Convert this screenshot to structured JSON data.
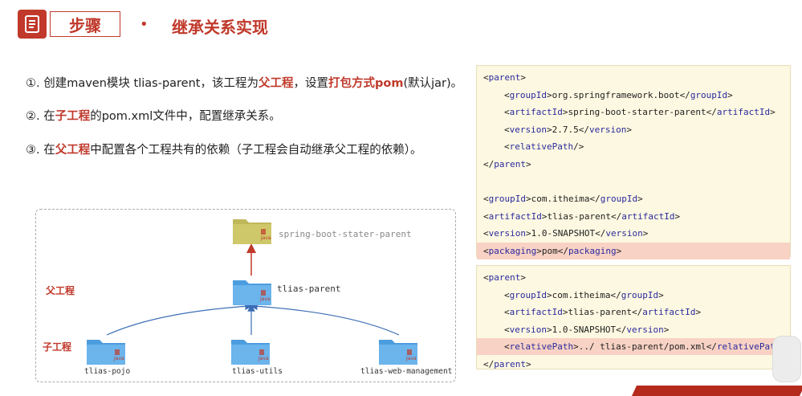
{
  "header": {
    "step_label": "步骤",
    "bullet": "•",
    "title": "继承关系实现"
  },
  "steps": [
    {
      "num": "①.",
      "segments": [
        {
          "text": " 创建maven模块 tlias-parent，该工程为",
          "style": "normal"
        },
        {
          "text": "父工程",
          "style": "red"
        },
        {
          "text": "，设置",
          "style": "normal"
        },
        {
          "text": "打包方式pom",
          "style": "red"
        },
        {
          "text": "(默认jar)。",
          "style": "normal"
        }
      ]
    },
    {
      "num": "②.",
      "segments": [
        {
          "text": " 在",
          "style": "normal"
        },
        {
          "text": "子工程",
          "style": "red"
        },
        {
          "text": "的pom.xml文件中，配置继承关系。",
          "style": "normal"
        }
      ]
    },
    {
      "num": "③.",
      "segments": [
        {
          "text": " 在",
          "style": "normal"
        },
        {
          "text": "父工程",
          "style": "red"
        },
        {
          "text": "中配置各个工程共有的依赖（子工程会自动继承父工程的依赖）。",
          "style": "normal"
        }
      ]
    }
  ],
  "diagram": {
    "parent_label": "父工程",
    "child_label": "子工程",
    "spring_parent": "spring-boot-stater-parent",
    "tlias_parent": "tlias-parent",
    "children": [
      "tlias-pojo",
      "tlias-utils",
      "tlias-web-management"
    ],
    "java_text": "Java"
  },
  "code_parent_pom": [
    {
      "indent": 0,
      "tag": "parent",
      "value": "",
      "close": false,
      "only_open": true
    },
    {
      "indent": 1,
      "tag": "groupId",
      "value": "org.springframework.boot"
    },
    {
      "indent": 1,
      "tag": "artifactId",
      "value": "spring-boot-starter-parent"
    },
    {
      "indent": 1,
      "tag": "version",
      "value": "2.7.5"
    },
    {
      "indent": 1,
      "tag": "relativePath",
      "value": "",
      "selfclose": true
    },
    {
      "indent": 0,
      "tag": "parent",
      "value": "",
      "only_close": true
    },
    {
      "indent": 0,
      "blank": true
    },
    {
      "indent": 0,
      "tag": "groupId",
      "value": "com.itheima"
    },
    {
      "indent": 0,
      "tag": "artifactId",
      "value": "tlias-parent"
    },
    {
      "indent": 0,
      "tag": "version",
      "value": "1.0-SNAPSHOT"
    },
    {
      "indent": 0,
      "tag": "packaging",
      "value": "pom",
      "highlight": true
    }
  ],
  "code_child_pom": [
    {
      "indent": 0,
      "tag": "parent",
      "only_open": true
    },
    {
      "indent": 1,
      "tag": "groupId",
      "value": "com.itheima"
    },
    {
      "indent": 1,
      "tag": "artifactId",
      "value": "tlias-parent"
    },
    {
      "indent": 1,
      "tag": "version",
      "value": "1.0-SNAPSHOT"
    },
    {
      "indent": 1,
      "tag": "relativePath",
      "value": "../ tlias-parent/pom.xml",
      "highlight": true
    },
    {
      "indent": 0,
      "tag": "parent",
      "only_close": true
    }
  ],
  "colors": {
    "accent": "#c0392b",
    "tag": "#2a2a9e",
    "code_bg": "#fdf8e1",
    "highlight": "#f8d2c4",
    "folder_blue": "#5aa8e6",
    "folder_olive": "#bfb85a"
  }
}
